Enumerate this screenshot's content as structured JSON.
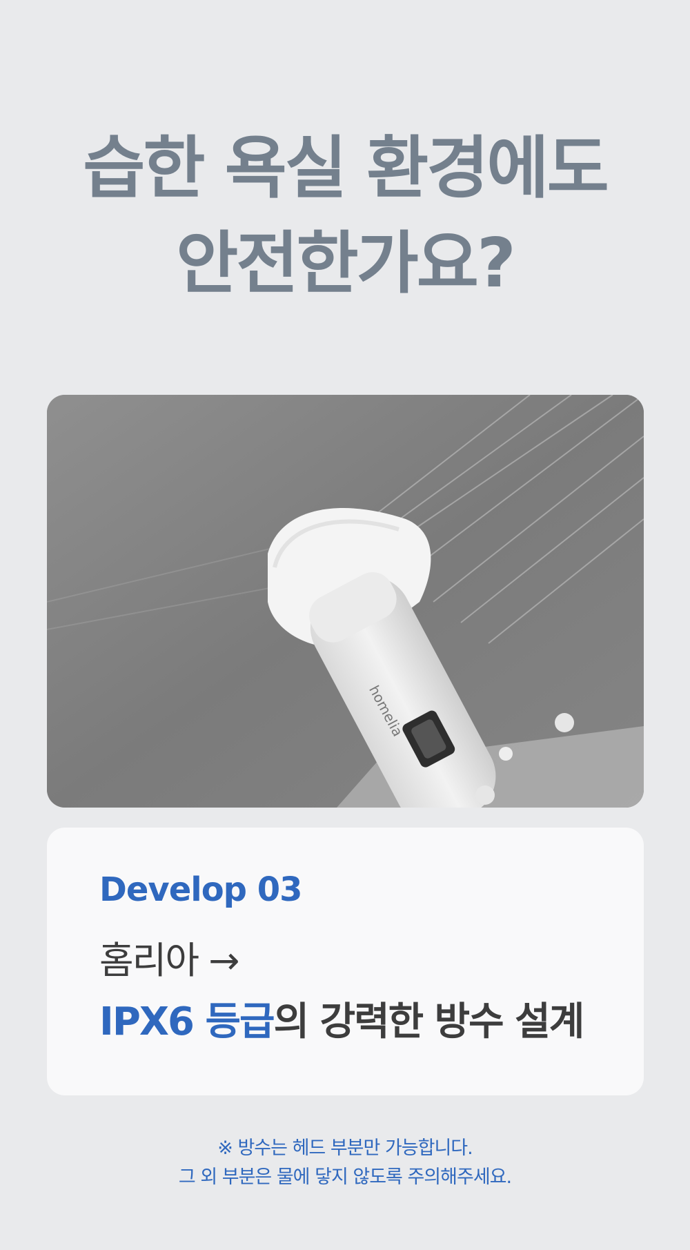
{
  "headline": {
    "line1": "습한 욕실 환경에도",
    "line2": "안전한가요?"
  },
  "photo": {
    "brand_on_device": "homelia"
  },
  "card": {
    "label": "Develop 03",
    "line1_text": "홈리아",
    "line1_arrow": "→",
    "line2_accent": "IPX6 등급",
    "line2_rest": "의 강력한 방수 설계"
  },
  "note": {
    "line1": "※ 방수는 헤드 부분만 가능합니다.",
    "line2": "그 외 부분은 물에 닿지 않도록 주의해주세요."
  },
  "colors": {
    "background": "#e9eaec",
    "headline": "#74808d",
    "accent": "#2f68be",
    "card": "#f9f9fa",
    "body_text": "#3d3d3d"
  }
}
